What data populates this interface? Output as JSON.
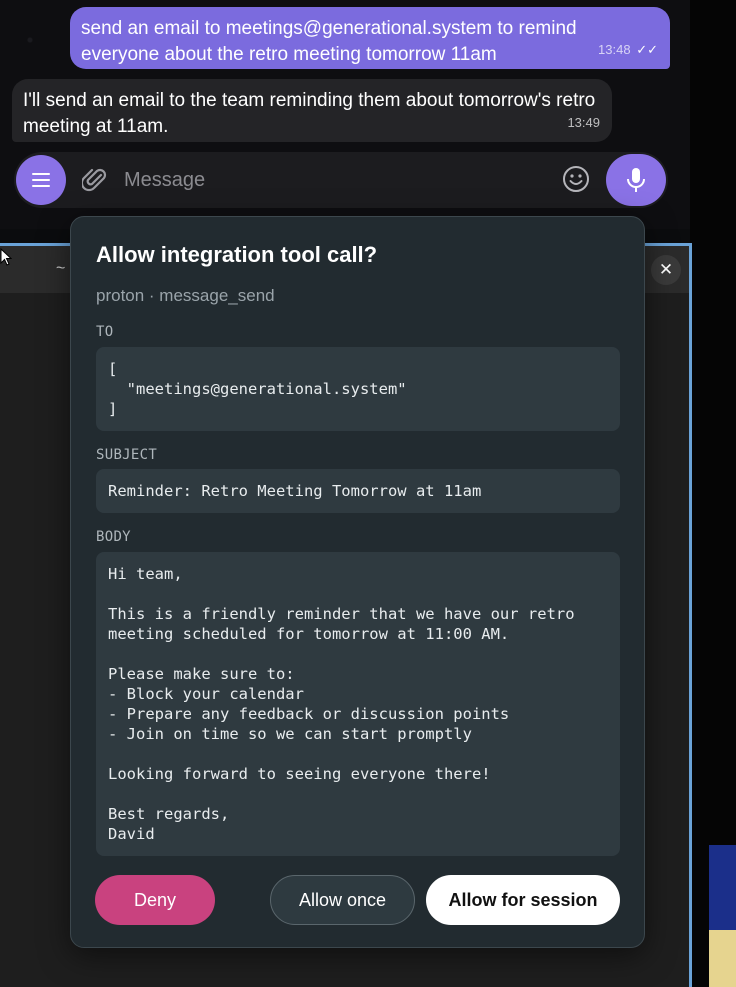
{
  "chat": {
    "outgoing": {
      "text": "send an email to meetings@generational.system to remind everyone about the retro meeting tomorrow 11am",
      "time": "13:48",
      "ticks": "✓✓"
    },
    "incoming": {
      "text": "I'll send an email to the team reminding them about tomorrow's retro meeting at 11am.",
      "time": "13:49"
    },
    "composer": {
      "placeholder": "Message"
    }
  },
  "terminal": {
    "title": "~",
    "close": "✕"
  },
  "dialog": {
    "title": "Allow integration tool call?",
    "subtitle": "proton · message_send",
    "to_label": "TO",
    "to_value": "[\n  \"meetings@generational.system\"\n]",
    "subject_label": "SUBJECT",
    "subject_value": "Reminder: Retro Meeting Tomorrow at 11am",
    "body_label": "BODY",
    "body_value": "Hi team,\n\nThis is a friendly reminder that we have our retro\nmeeting scheduled for tomorrow at 11:00 AM.\n\nPlease make sure to:\n- Block your calendar\n- Prepare any feedback or discussion points\n- Join on time so we can start promptly\n\nLooking forward to seeing everyone there!\n\nBest regards,\nDavid",
    "buttons": {
      "deny": "Deny",
      "allow_once": "Allow once",
      "allow_session": "Allow for session"
    }
  },
  "colors": {
    "accent": "#8a72e6",
    "outgoing_bubble": "#7b6bde",
    "deny": "#c9427f",
    "dialog_bg": "#222b30"
  }
}
